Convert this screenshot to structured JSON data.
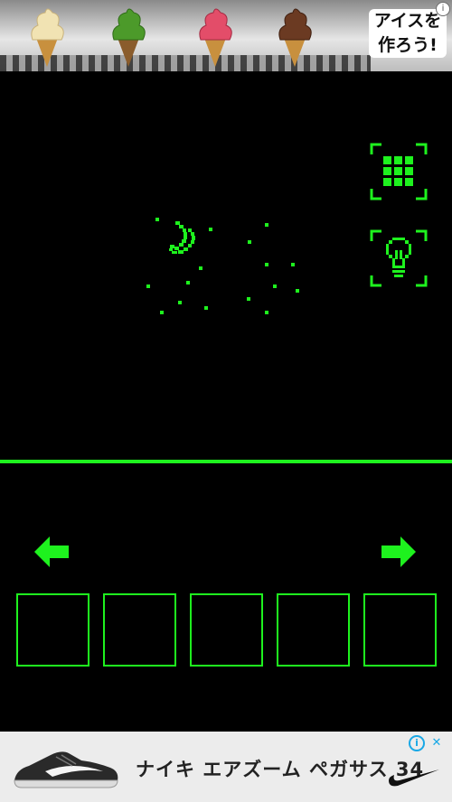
{
  "top_ad": {
    "text_line1": "アイスを",
    "text_line2": "作ろう!",
    "info_icon": "i",
    "cones": [
      {
        "name": "vanilla",
        "color": "#f1e3b3"
      },
      {
        "name": "matcha",
        "color": "#4c9a2a"
      },
      {
        "name": "strawberry",
        "color": "#e34d69"
      },
      {
        "name": "chocolate",
        "color": "#6b3a22"
      }
    ]
  },
  "game": {
    "accent": "#1ef21e",
    "background": "#000000",
    "menu_icon": "grid-icon",
    "hint_icon": "lightbulb-icon",
    "nav_left_icon": "arrow-left-icon",
    "nav_right_icon": "arrow-right-icon",
    "inventory_slots": 5
  },
  "bottom_ad": {
    "title": "ナイキ エアズーム ペガサス 34",
    "info_icon": "i",
    "close_icon": "✕",
    "brand_icon": "swoosh-icon"
  }
}
